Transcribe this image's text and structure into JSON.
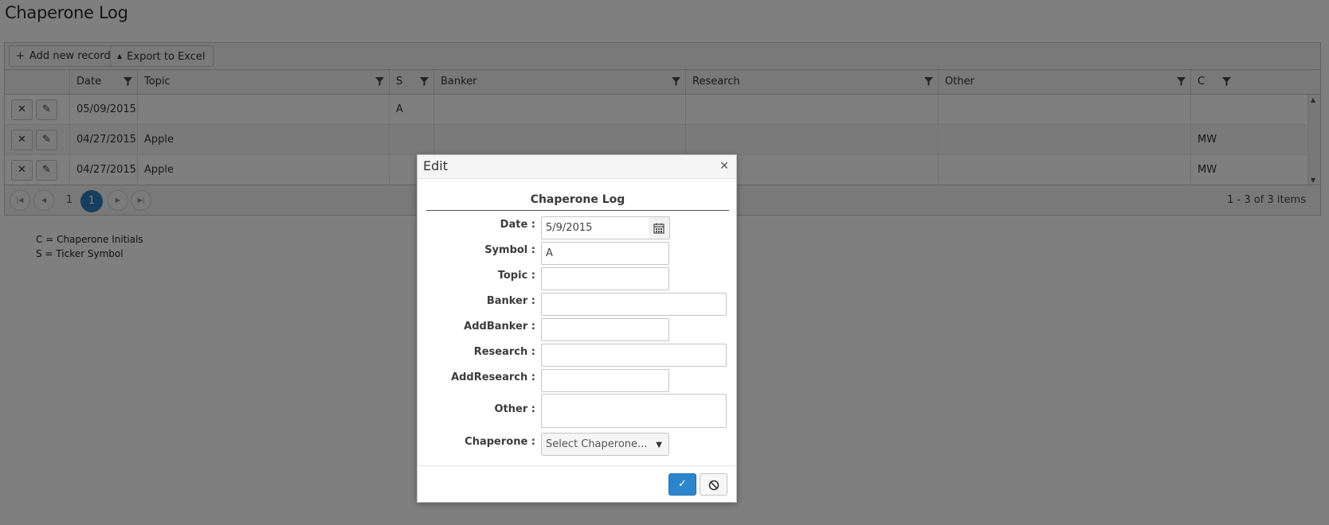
{
  "page": {
    "title": "Chaperone Log"
  },
  "toolbar": {
    "add_label": "Add new record",
    "export_label": "Export to Excel"
  },
  "columns": [
    "Date",
    "Topic",
    "S",
    "Banker",
    "Research",
    "Other",
    "C"
  ],
  "rows": [
    {
      "date": "05/09/2015",
      "topic": "",
      "s": "A",
      "banker": "",
      "research": "",
      "other": "",
      "c": ""
    },
    {
      "date": "04/27/2015",
      "topic": "Apple",
      "s": "",
      "banker": "",
      "research": "",
      "other": "",
      "c": "MW"
    },
    {
      "date": "04/27/2015",
      "topic": "Apple",
      "s": "",
      "banker": "",
      "research": "",
      "other": "",
      "c": "MW"
    }
  ],
  "pager": {
    "page_number": "1",
    "current_page": "1",
    "info": "1 - 3 of 3 items"
  },
  "legend": {
    "c_line": "C = Chaperone Initials",
    "s_line": "S = Ticker Symbol"
  },
  "modal": {
    "title": "Edit",
    "form_heading": "Chaperone Log",
    "labels": {
      "date": "Date :",
      "symbol": "Symbol :",
      "topic": "Topic :",
      "banker": "Banker :",
      "add_banker": "AddBanker :",
      "research": "Research :",
      "add_research": "AddResearch :",
      "other": "Other :",
      "chaperone": "Chaperone :"
    },
    "values": {
      "date": "5/9/2015",
      "symbol": "A",
      "topic": "",
      "banker": "",
      "add_banker": "",
      "research": "",
      "add_research": "",
      "other": ""
    },
    "chaperone_placeholder": "Select Chaperone..."
  },
  "colors": {
    "primary": "#2c86cd",
    "pager_current": "#2a7dbf",
    "overlay": "rgba(0,0,0,0.5)"
  }
}
